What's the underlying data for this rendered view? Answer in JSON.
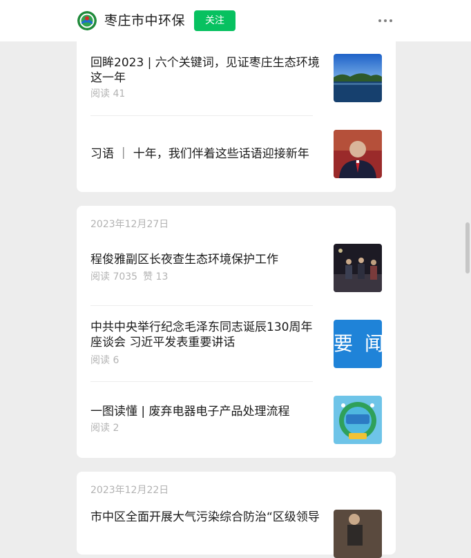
{
  "header": {
    "account_name": "枣庄市中环保",
    "follow_label": "关注"
  },
  "cards": [
    {
      "items": [
        {
          "title": "回眸2023 | 六个关键词，见证枣庄生态环境这一年",
          "reads": "阅读 41"
        },
        {
          "title": "习语 ｜ 十年，我们伴着这些话语迎接新年"
        }
      ]
    },
    {
      "date": "2023年12月27日",
      "items": [
        {
          "title": "程俊雅副区长夜查生态环境保护工作",
          "reads": "阅读 7035",
          "likes": "赞 13"
        },
        {
          "title": "中共中央举行纪念毛泽东同志诞辰130周年座谈会 习近平发表重要讲话",
          "reads": "阅读 6",
          "thumb_text": "要 闻"
        },
        {
          "title": "一图读懂 | 废弃电器电子产品处理流程",
          "reads": "阅读 2"
        }
      ]
    },
    {
      "date": "2023年12月22日",
      "items": [
        {
          "title": "市中区全面开展大气污染综合防治“区级领导"
        }
      ]
    }
  ],
  "colors": {
    "accent": "#07c160",
    "background": "#ededed",
    "muted_text": "#b2b2b2"
  },
  "icons": {
    "more": "more-dots-icon",
    "logo": "logo-icon"
  }
}
